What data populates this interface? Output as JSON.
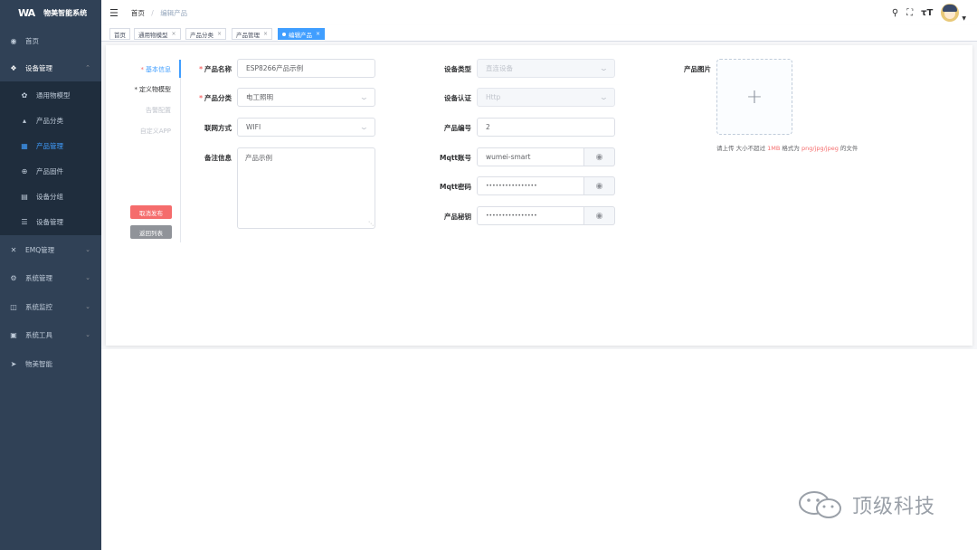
{
  "app": {
    "title": "物美智能系统",
    "logo_mark": "WA"
  },
  "sidebar": {
    "items": [
      {
        "label": "首页",
        "icon": "dashboard-icon"
      },
      {
        "label": "设备管理",
        "icon": "device-icon",
        "expanded": true
      },
      {
        "label": "通用物模型",
        "icon": "model-icon"
      },
      {
        "label": "产品分类",
        "icon": "category-icon"
      },
      {
        "label": "产品管理",
        "icon": "grid-icon",
        "active": true
      },
      {
        "label": "产品固件",
        "icon": "firmware-icon"
      },
      {
        "label": "设备分组",
        "icon": "group-icon"
      },
      {
        "label": "设备管理",
        "icon": "list-icon"
      },
      {
        "label": "EMQ管理",
        "icon": "emq-icon"
      },
      {
        "label": "系统管理",
        "icon": "gear-icon"
      },
      {
        "label": "系统监控",
        "icon": "monitor-icon"
      },
      {
        "label": "系统工具",
        "icon": "tool-icon"
      },
      {
        "label": "物美智能",
        "icon": "send-icon"
      }
    ]
  },
  "header": {
    "breadcrumb": [
      "首页",
      "编辑产品"
    ],
    "icons": [
      "search-icon",
      "fullscreen-icon",
      "font-size-icon",
      "avatar"
    ]
  },
  "tags": [
    {
      "label": "首页"
    },
    {
      "label": "通用物模型"
    },
    {
      "label": "产品分类"
    },
    {
      "label": "产品管理"
    },
    {
      "label": "编辑产品",
      "active": true
    }
  ],
  "steps": {
    "basic": "基本信息",
    "model": "定义物模型",
    "alert": "告警配置",
    "app": "自定义APP",
    "required_mark": "*"
  },
  "buttons": {
    "cancel_publish": "取消发布",
    "back": "返回列表"
  },
  "form": {
    "product_name": {
      "label": "产品名称",
      "value": "ESP8266产品示例"
    },
    "category": {
      "label": "产品分类",
      "value": "电工照明"
    },
    "network": {
      "label": "联网方式",
      "value": "WIFI"
    },
    "remark": {
      "label": "备注信息",
      "value": "产品示例"
    },
    "device_type": {
      "label": "设备类型",
      "value": "直连设备"
    },
    "auth": {
      "label": "设备认证",
      "value": "Http"
    },
    "product_no": {
      "label": "产品编号",
      "value": "2"
    },
    "mqtt_account": {
      "label": "Mqtt账号",
      "value": "wumei-smart"
    },
    "mqtt_password": {
      "label": "Mqtt密码",
      "value": "••••••••••••••••"
    },
    "product_secret": {
      "label": "产品秘钥",
      "value": "••••••••••••••••"
    },
    "image": {
      "label": "产品图片"
    }
  },
  "upload_tip": {
    "prefix": "请上传 大小不超过 ",
    "size": "1MB",
    "mid": " 格式为 ",
    "formats": "png/jpg/jpeg",
    "suffix": " 的文件"
  },
  "watermark": "顶级科技",
  "colors": {
    "primary": "#409eff",
    "danger": "#f56c6c",
    "sidebar": "#304156"
  }
}
